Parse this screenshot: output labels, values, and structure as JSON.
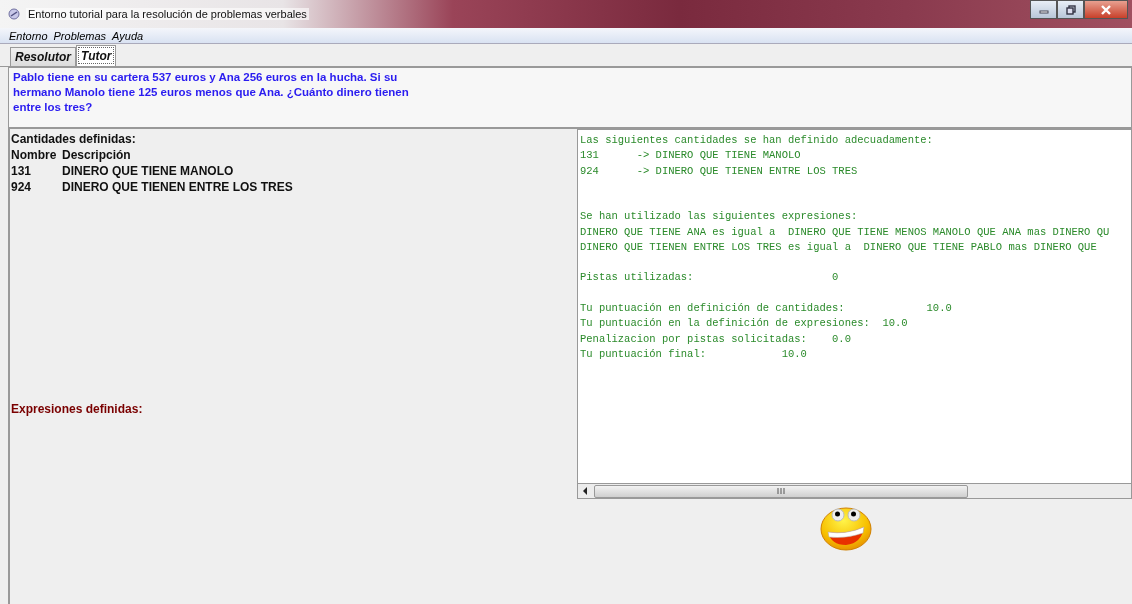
{
  "window": {
    "title": "Entorno tutorial para la resolución de problemas verbales"
  },
  "menu": [
    "Entorno",
    "Problemas",
    "Ayuda"
  ],
  "tabs": [
    {
      "label": "Resolutor",
      "selected": false
    },
    {
      "label": "Tutor",
      "selected": true
    }
  ],
  "problem": "Pablo tiene en su cartera 537 euros y Ana 256 euros en la hucha. Si su hermano Manolo tiene 125 euros menos que Ana. ¿Cuánto dinero tienen entre los tres?",
  "quantities": {
    "title": "Cantidades definidas:",
    "columns": [
      "Nombre",
      "Descripción"
    ],
    "rows": [
      {
        "name": "131",
        "description": "DINERO QUE TIENE MANOLO"
      },
      {
        "name": "924",
        "description": "DINERO QUE TIENEN ENTRE LOS TRES"
      }
    ]
  },
  "expressions": {
    "title": "Expresiones definidas:"
  },
  "output": {
    "blocks": [
      [
        "Las siguientes cantidades se han definido adecuadamente:",
        "131      -> DINERO QUE TIENE MANOLO",
        "924      -> DINERO QUE TIENEN ENTRE LOS TRES"
      ],
      [
        "Se han utilizado las siguientes expresiones:",
        "DINERO QUE TIENE ANA es igual a  DINERO QUE TIENE MENOS MANOLO QUE ANA mas DINERO QU",
        "DINERO QUE TIENEN ENTRE LOS TRES es igual a  DINERO QUE TIENE PABLO mas DINERO QUE"
      ],
      [
        "Pistas utilizadas:                      0"
      ],
      [
        "Tu puntuación en definición de cantidades:             10.0",
        "Tu puntuación en la definición de expresiones:  10.0",
        "Penalizacion por pistas solicitadas:    0.0",
        "Tu puntuación final:            10.0"
      ]
    ]
  }
}
